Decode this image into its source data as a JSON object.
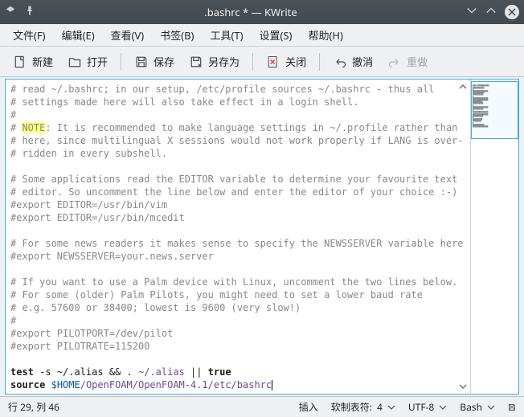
{
  "titlebar": {
    "title": ".bashrc * — KWrite"
  },
  "menu": {
    "file": "文件(F)",
    "edit": "编辑(E)",
    "view": "查看(V)",
    "bookmarks": "书签(B)",
    "tools": "工具(T)",
    "settings": "设置(S)",
    "help": "帮助(H)"
  },
  "toolbar": {
    "new": "新建",
    "open": "打开",
    "save": "保存",
    "saveas": "另存为",
    "close": "关闭",
    "undo": "撤消",
    "redo": "重做"
  },
  "code": {
    "l1a": "# read ~/.bashrc; in our setup, /etc/profile sources ~/.bashrc - thus all",
    "l2a": "# settings made here will also take effect in a login shell.",
    "l3": "#",
    "l4pre": "# ",
    "l4note": "NOTE",
    "l4post": ": It is recommended to make language settings in ~/.profile rather than",
    "l5": "# here, since multilingual X sessions would not work properly if LANG is over-",
    "l6": "# ridden in every subshell.",
    "l8": "# Some applications read the EDITOR variable to determine your favourite text",
    "l9": "# editor. So uncomment the line below and enter the editor of your choice :-)",
    "l10": "#export EDITOR=/usr/bin/vim",
    "l11": "#export EDITOR=/usr/bin/mcedit",
    "l13": "# For some news readers it makes sense to specify the NEWSSERVER variable here",
    "l14": "#export NEWSSERVER=your.news.server",
    "l16": "# If you want to use a Palm device with Linux, uncomment the two lines below.",
    "l17": "# For some (older) Palm Pilots, you might need to set a lower baud rate",
    "l18": "# e.g. 57600 or 38400; lowest is 9600 (very slow!)",
    "l19": "#",
    "l20": "#export PILOTPORT=/dev/pilot",
    "l21": "#export PILOTRATE=115200",
    "l23_test": "test",
    "l23_s": " -s ~/.alias ",
    "l23_and": "&&",
    "l23_dot": " . ",
    "l23_file": "~/.alias",
    "l23_or": " || ",
    "l23_true": "true",
    "l24_source": "source",
    "l24_sp": " ",
    "l24_home": "$HOME",
    "l24_path": "/OpenFOAM/OpenFOAM-4.1/etc/bashrc"
  },
  "status": {
    "position": "行 29, 列 46",
    "mode": "插入",
    "softtab_label": "软制表符:",
    "softtab_value": "4",
    "encoding": "UTF-8",
    "syntax": "Bash"
  }
}
